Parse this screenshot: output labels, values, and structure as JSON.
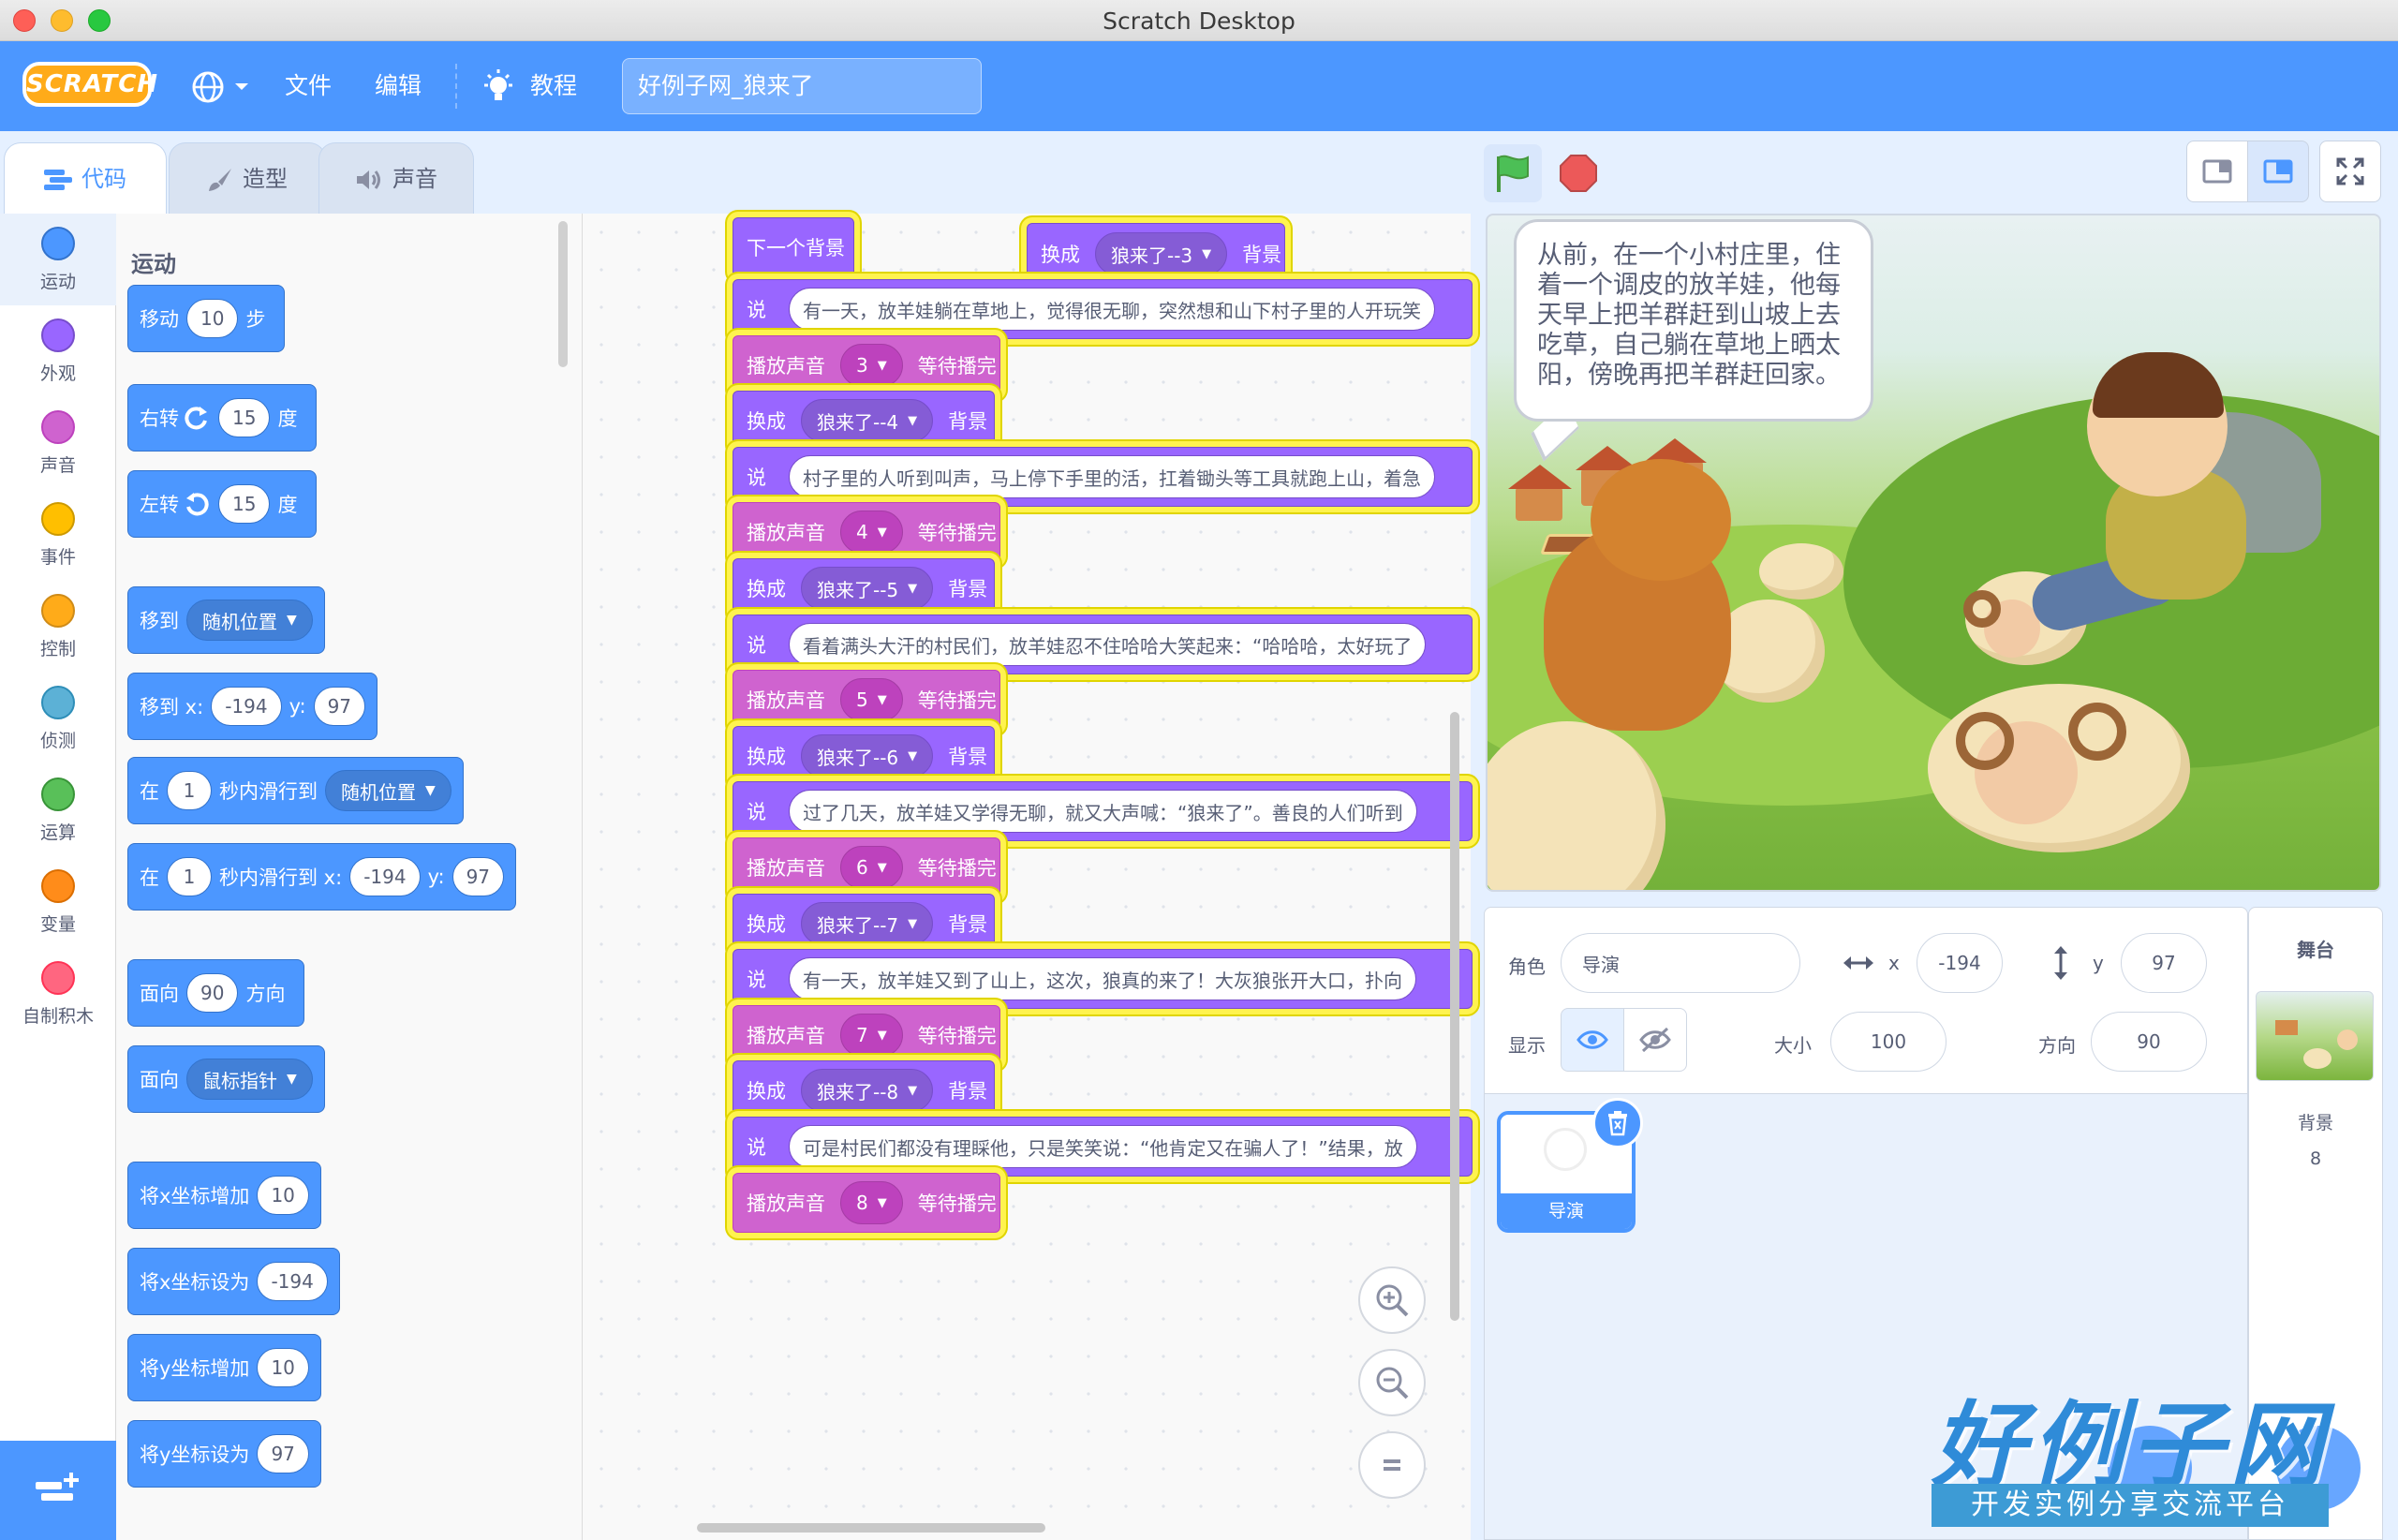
{
  "window": {
    "title": "Scratch Desktop"
  },
  "menubar": {
    "logo": "SCRATCH",
    "file": "文件",
    "edit": "编辑",
    "tutorials": "教程",
    "project_title": "好例子网_狼来了"
  },
  "tabs": {
    "code": "代码",
    "costumes": "造型",
    "sounds": "声音"
  },
  "categories": [
    {
      "label": "运动",
      "color": "#4c97ff"
    },
    {
      "label": "外观",
      "color": "#9966ff"
    },
    {
      "label": "声音",
      "color": "#cf63cf"
    },
    {
      "label": "事件",
      "color": "#ffbf00"
    },
    {
      "label": "控制",
      "color": "#ffab19"
    },
    {
      "label": "侦测",
      "color": "#5cb1d6"
    },
    {
      "label": "运算",
      "color": "#59c059"
    },
    {
      "label": "变量",
      "color": "#ff8c1a"
    },
    {
      "label": "自制积木",
      "color": "#ff6680"
    }
  ],
  "palette": {
    "section": "运动",
    "move": {
      "a": "移动",
      "v": "10",
      "b": "步"
    },
    "turn_right": {
      "a": "右转",
      "v": "15",
      "b": "度"
    },
    "turn_left": {
      "a": "左转",
      "v": "15",
      "b": "度"
    },
    "goto": {
      "a": "移到",
      "d": "随机位置"
    },
    "goto_xy": {
      "a": "移到 x:",
      "x": "-194",
      "b": "y:",
      "y": "97"
    },
    "glide": {
      "a": "在",
      "v": "1",
      "b": "秒内滑行到",
      "d": "随机位置"
    },
    "glide_xy": {
      "a": "在",
      "v": "1",
      "b": "秒内滑行到 x:",
      "x": "-194",
      "c": "y:",
      "y": "97"
    },
    "point_dir": {
      "a": "面向",
      "v": "90",
      "b": "方向"
    },
    "point_towards": {
      "a": "面向",
      "d": "鼠标指针"
    },
    "change_x": {
      "a": "将x坐标增加",
      "v": "10"
    },
    "set_x": {
      "a": "将x坐标设为",
      "v": "-194"
    },
    "change_y": {
      "a": "将y坐标增加",
      "v": "10"
    },
    "set_y": {
      "a": "将y坐标设为",
      "v": "97"
    }
  },
  "script": {
    "next_backdrop": "下一个背景",
    "top_switch": {
      "a": "换成",
      "d": "狼来了--3",
      "b": "背景"
    },
    "blocks": [
      {
        "type": "say",
        "a": "说",
        "text": "有一天，放羊娃躺在草地上，觉得很无聊，突然想和山下村子里的人开玩笑"
      },
      {
        "type": "sound",
        "a": "播放声音",
        "d": "3",
        "b": "等待播完"
      },
      {
        "type": "switch",
        "a": "换成",
        "d": "狼来了--4",
        "b": "背景"
      },
      {
        "type": "say",
        "a": "说",
        "text": "村子里的人听到叫声，马上停下手里的活，扛着锄头等工具就跑上山，着急"
      },
      {
        "type": "sound",
        "a": "播放声音",
        "d": "4",
        "b": "等待播完"
      },
      {
        "type": "switch",
        "a": "换成",
        "d": "狼来了--5",
        "b": "背景"
      },
      {
        "type": "say",
        "a": "说",
        "text": "看着满头大汗的村民们，放羊娃忍不住哈哈大笑起来：“哈哈哈，太好玩了"
      },
      {
        "type": "sound",
        "a": "播放声音",
        "d": "5",
        "b": "等待播完"
      },
      {
        "type": "switch",
        "a": "换成",
        "d": "狼来了--6",
        "b": "背景"
      },
      {
        "type": "say",
        "a": "说",
        "text": "过了几天，放羊娃又学得无聊，就又大声喊：“狼来了”。善良的人们听到"
      },
      {
        "type": "sound",
        "a": "播放声音",
        "d": "6",
        "b": "等待播完"
      },
      {
        "type": "switch",
        "a": "换成",
        "d": "狼来了--7",
        "b": "背景"
      },
      {
        "type": "say",
        "a": "说",
        "text": "有一天，放羊娃又到了山上，这次，狼真的来了！大灰狼张开大口，扑向"
      },
      {
        "type": "sound",
        "a": "播放声音",
        "d": "7",
        "b": "等待播完"
      },
      {
        "type": "switch",
        "a": "换成",
        "d": "狼来了--8",
        "b": "背景"
      },
      {
        "type": "say",
        "a": "说",
        "text": "可是村民们都没有理睬他，只是笑笑说：“他肯定又在骗人了！”结果，放"
      },
      {
        "type": "sound",
        "a": "播放声音",
        "d": "8",
        "b": "等待播完"
      }
    ]
  },
  "stage": {
    "speech": "从前，在一个小村庄里，住着一个调皮的放羊娃，他每天早上把羊群赶到山坡上去吃草，自己躺在草地上晒太阳，傍晚再把羊群赶回家。"
  },
  "sprite_info": {
    "sprite_label": "角色",
    "sprite_name": "导演",
    "x_label": "x",
    "x_value": "-194",
    "y_label": "y",
    "y_value": "97",
    "show_label": "显示",
    "size_label": "大小",
    "size_value": "100",
    "direction_label": "方向",
    "direction_value": "90"
  },
  "sprites": [
    {
      "name": "导演"
    }
  ],
  "stage_selector": {
    "title": "舞台",
    "backdrops_label": "背景",
    "backdrops_count": "8"
  },
  "watermark": {
    "title": "好例子网",
    "subtitle": "开发实例分享交流平台"
  },
  "colors": {
    "accent": "#4c97ff",
    "looks": "#9966ff",
    "sound": "#cf63cf",
    "highlight": "#fff34f"
  }
}
